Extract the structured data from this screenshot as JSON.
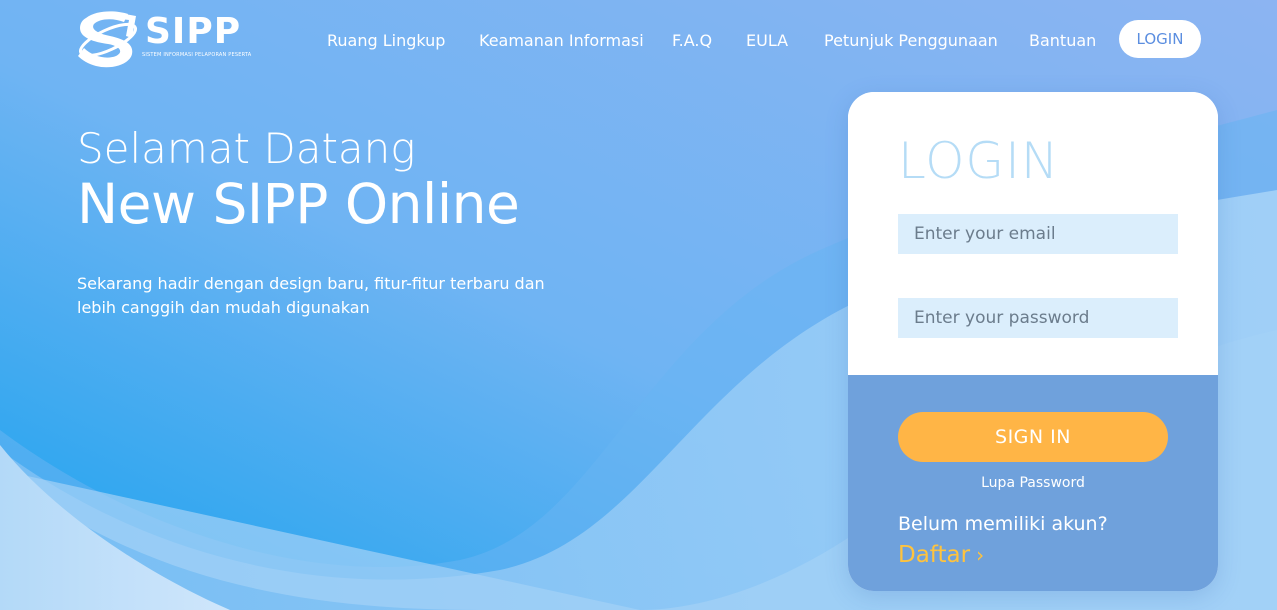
{
  "brand": {
    "name": "SIPP",
    "tagline": "SISTEM INFORMASI PELAPORAN PESERTA",
    "logo_icon": "sipp-logo-icon"
  },
  "nav": {
    "items": [
      {
        "label": "Ruang Lingkup"
      },
      {
        "label": "Keamanan Informasi"
      },
      {
        "label": "F.A.Q"
      },
      {
        "label": "EULA"
      },
      {
        "label": "Petunjuk Penggunaan"
      },
      {
        "label": "Bantuan"
      }
    ],
    "login_label": "LOGIN"
  },
  "hero": {
    "greeting": "Selamat Datang",
    "title": "New SIPP Online",
    "description": "Sekarang hadir dengan design baru, fitur-fitur terbaru dan lebih canggih dan mudah digunakan"
  },
  "login_card": {
    "heading": "LOGIN",
    "email_placeholder": "Enter your email",
    "email_value": "",
    "password_placeholder": "Enter your password",
    "password_value": "",
    "signin_label": "SIGN IN",
    "forgot_label": "Lupa Password",
    "no_account_text": "Belum memiliki akun?",
    "register_label": "Daftar",
    "register_icon": "chevron-right-icon"
  },
  "colors": {
    "accent_orange": "#ffb546",
    "register_yellow": "#ffc33d",
    "card_bottom": "#6fa1dc",
    "login_heading": "#b5dcf6",
    "input_bg": "#dbeefc",
    "gradient_left": "#22a6ef",
    "gradient_right": "#8cb6f2"
  }
}
